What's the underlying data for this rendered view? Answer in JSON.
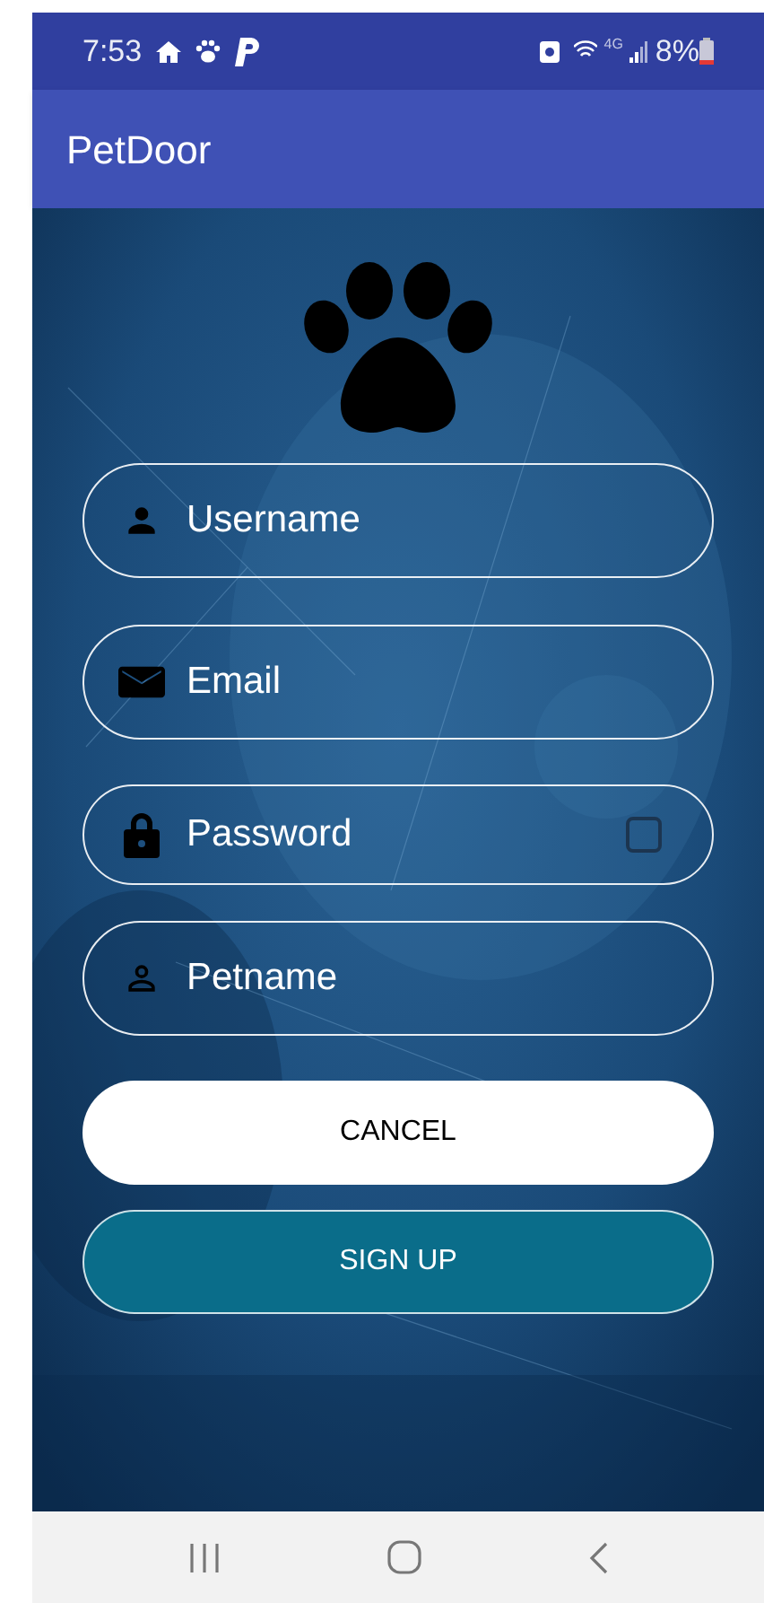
{
  "status_bar": {
    "time": "7:53",
    "network": "4G",
    "battery": "8%"
  },
  "app_bar": {
    "title": "PetDoor"
  },
  "fields": [
    {
      "placeholder": "Username"
    },
    {
      "placeholder": "Email"
    },
    {
      "placeholder": "Password",
      "show_password": {
        "checked": false
      }
    },
    {
      "placeholder": "Petname"
    }
  ],
  "buttons": [
    {
      "label": "CANCEL",
      "kind": "secondary"
    },
    {
      "label": "SIGN UP",
      "kind": "primary"
    }
  ]
}
